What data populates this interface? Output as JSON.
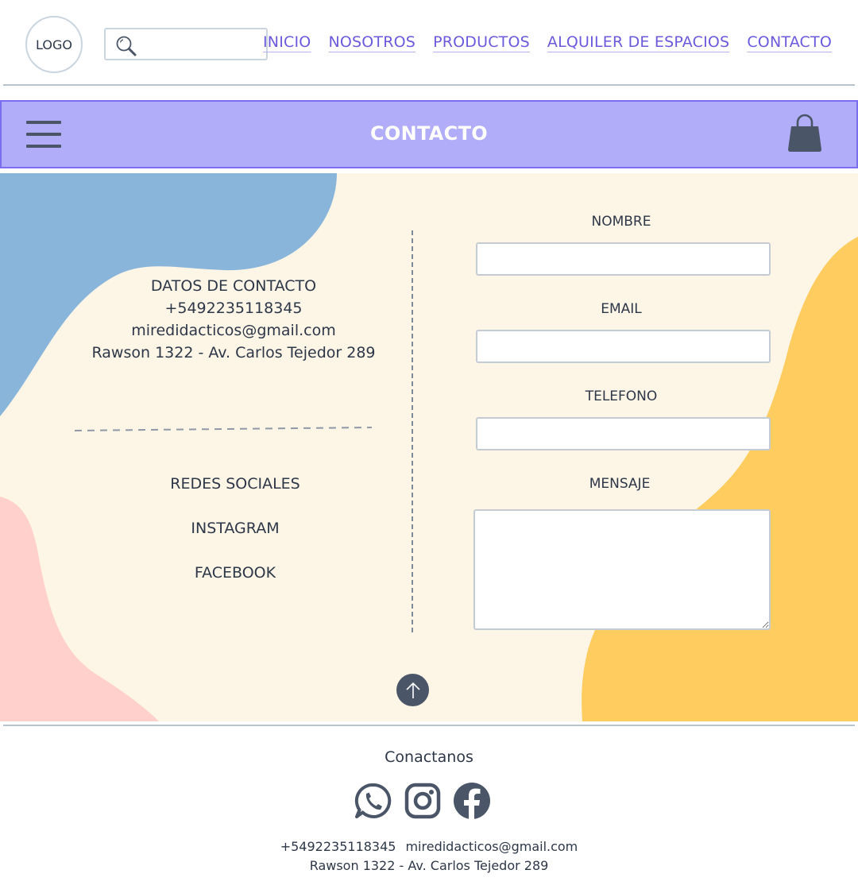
{
  "header": {
    "logo_text": "LOGO",
    "search": {
      "placeholder": "",
      "value": ""
    },
    "nav": [
      {
        "label": "INICIO"
      },
      {
        "label": "NOSOTROS"
      },
      {
        "label": "PRODUCTOS"
      },
      {
        "label": "ALQUILER DE ESPACIOS"
      },
      {
        "label": "CONTACTO"
      }
    ]
  },
  "band": {
    "title": "CONTACTO",
    "menu_icon": "hamburger-menu-icon",
    "cart_icon": "shopping-bag-icon"
  },
  "contact": {
    "heading": "DATOS DE CONTACTO",
    "phone": "+5492235118345",
    "email": "miredidacticos@gmail.com",
    "address": "Rawson 1322 - Av. Carlos Tejedor 289"
  },
  "social": {
    "heading": "REDES SOCIALES",
    "instagram": "INSTAGRAM",
    "facebook": "FACEBOOK"
  },
  "form": {
    "name_label": "NOMBRE",
    "email_label": "EMAIL",
    "phone_label": "TELEFONO",
    "message_label": "MENSAJE"
  },
  "scroll_top_icon": "arrow-up-icon",
  "footer": {
    "title": "Conactanos",
    "icons": [
      "whatsapp-icon",
      "instagram-icon",
      "facebook-icon"
    ],
    "phone": "+5492235118345",
    "email": "miredidacticos@gmail.com",
    "address": "Rawson 1322 - Av. Carlos Tejedor 289"
  },
  "colors": {
    "nav_link": "#6b5bdc",
    "band_background": "#b1adf8",
    "band_border": "#7b6ef0",
    "main_background": "#fdf5e6",
    "blob_blue": "#89b5db",
    "blob_pink": "#ffd0cc",
    "blob_yellow": "#ffcc5f",
    "icon_dark": "#4a5668"
  }
}
